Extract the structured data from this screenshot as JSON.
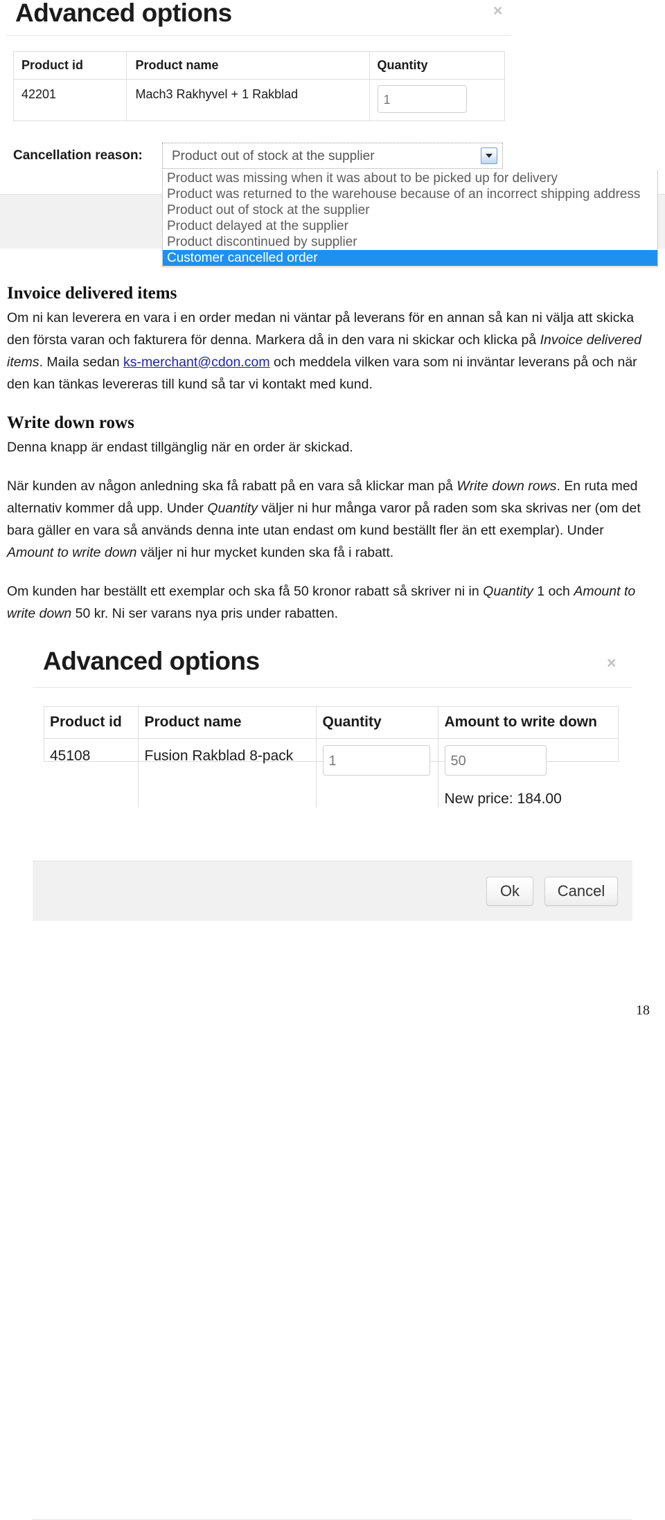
{
  "page": {
    "number": "18"
  },
  "dialog_top": {
    "title": "Advanced options",
    "close_label": "×",
    "table": {
      "columns": [
        "Product id",
        "Product name",
        "Quantity"
      ],
      "rows": [
        {
          "product_id": "42201",
          "product_name": "Mach3 Rakhyvel + 1 Rakblad",
          "quantity": "1"
        }
      ]
    },
    "cancellation": {
      "label": "Cancellation reason:",
      "selected_value": "Product out of stock at the supplier",
      "options": [
        "Product was missing when it was about to be picked up for delivery",
        "Product was returned to the warehouse because of an incorrect shipping address",
        "Product out of stock at the supplier",
        "Product delayed at the supplier",
        "Product discontinued by supplier",
        "Customer cancelled order"
      ],
      "highlighted_index": 5,
      "highlight_color": "#1f90ee"
    }
  },
  "section_invoice": {
    "heading": "Invoice delivered items",
    "paragraph_parts": {
      "p1": "Om ni kan leverera en vara i en order medan ni väntar på leverans för en annan så kan ni välja att skicka den första varan och fakturera för denna. Markera då in den vara ni skickar och klicka på ",
      "em1": "Invoice delivered items",
      "p2": ". Maila sedan ",
      "link": "ks-merchant@cdon.com",
      "p3": " och meddela vilken vara som ni inväntar leverans på och när den kan tänkas levereras till kund så tar vi kontakt med kund."
    }
  },
  "section_writedown": {
    "heading": "Write down rows",
    "intro": "Denna knapp är endast tillgänglig när en order är skickad.",
    "paragraph_parts": {
      "p1": "När kunden av någon anledning ska få rabatt på en vara så klickar man på ",
      "em1": "Write down rows",
      "p2": ". En ruta med alternativ kommer då upp. Under ",
      "em2": "Quantity",
      "p3": " väljer ni hur många varor på raden som ska skrivas ner (om det bara gäller en vara så används denna inte utan endast om kund beställt fler än ett exemplar). Under ",
      "em3": "Amount to write down",
      "p4": " väljer ni hur mycket kunden ska få i rabatt."
    },
    "example_parts": {
      "p1": "Om kunden har beställt ett exemplar och ska få 50 kronor rabatt så skriver ni in ",
      "em1": "Quantity",
      "p2": " 1 och ",
      "em2": "Amount to write down",
      "p3": " 50 kr. Ni ser varans nya pris under rabatten."
    }
  },
  "dialog_bottom": {
    "title": "Advanced options",
    "close_label": "×",
    "table": {
      "columns": [
        "Product id",
        "Product name",
        "Quantity",
        "Amount to write down"
      ],
      "rows": [
        {
          "product_id": "45108",
          "product_name": "Fusion Rakblad 8-pack",
          "quantity": "1",
          "amount": "50",
          "new_price": "New price: 184.00"
        }
      ]
    },
    "buttons": {
      "ok": "Ok",
      "cancel": "Cancel"
    }
  }
}
